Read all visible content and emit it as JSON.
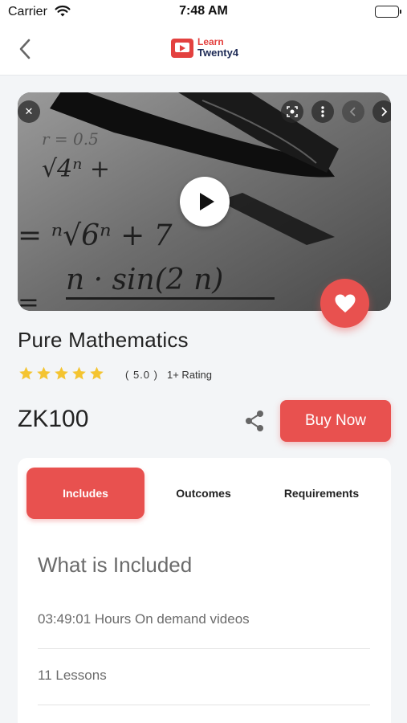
{
  "status_bar": {
    "carrier": "Carrier",
    "time": "7:48 AM"
  },
  "nav": {
    "logo_line1": "Learn",
    "logo_line2": "Twenty4"
  },
  "course": {
    "title": "Pure Mathematics",
    "rating_value": "( 5.0 )",
    "rating_count": "1+ Rating",
    "stars": 5,
    "price": "ZK100",
    "buy_label": "Buy Now"
  },
  "tabs": [
    {
      "label": "Includes",
      "active": true
    },
    {
      "label": "Outcomes",
      "active": false
    },
    {
      "label": "Requirements",
      "active": false
    }
  ],
  "includes": {
    "heading": "What is Included",
    "items": [
      "03:49:01 Hours On demand videos",
      "11 Lessons"
    ]
  },
  "media": {
    "overlay_buttons": [
      "close-icon",
      "lens-icon",
      "more-vertical-icon",
      "chevron-left-icon",
      "chevron-right-icon"
    ],
    "thumbnail": "math-formula-pen"
  },
  "colors": {
    "accent": "#e8514f",
    "star": "#f4c430",
    "background": "#f3f5f7"
  }
}
